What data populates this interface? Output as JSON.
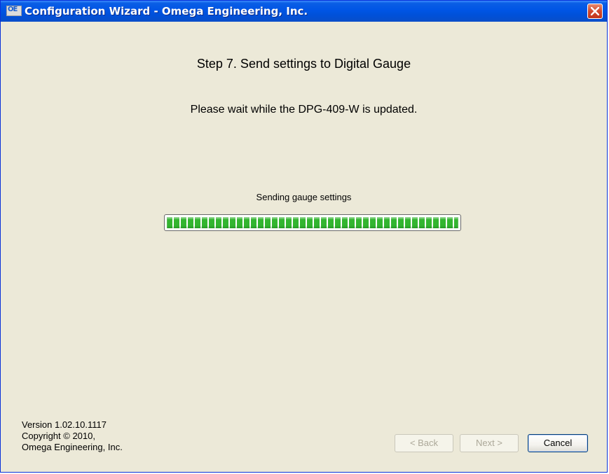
{
  "window": {
    "title": "Configuration Wizard - Omega Engineering, Inc.",
    "app_icon_text": "OE"
  },
  "wizard": {
    "step_title": "Step 7.  Send settings to Digital Gauge",
    "instruction": "Please wait while the DPG-409-W is updated.",
    "progress_label": "Sending gauge settings",
    "progress_fraction": 1.0
  },
  "footer": {
    "version": "Version 1.02.10.1117",
    "copyright": "Copyright © 2010,",
    "company": "Omega Engineering, Inc."
  },
  "buttons": {
    "back_label": "< Back",
    "next_label": "Next >",
    "cancel_label": "Cancel"
  },
  "colors": {
    "titlebar": "#0055e5",
    "progress_fill": "#33b530",
    "window_bg": "#ece9d8",
    "close_button": "#d1482c"
  },
  "icons": {
    "app": "omega-app-icon",
    "close": "close-icon"
  }
}
